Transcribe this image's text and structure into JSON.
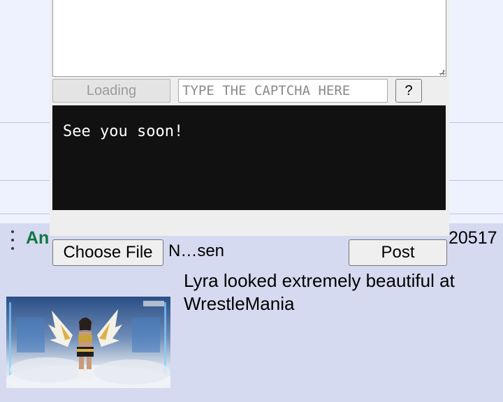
{
  "form": {
    "comment_value": "",
    "captcha_loading_label": "Loading",
    "captcha_placeholder": "TYPE THE CAPTCHA HERE",
    "captcha_help_label": "?",
    "captcha_text": "See you soon!",
    "choose_file_label": "Choose File",
    "file_name": "N…sen",
    "post_label": "Post"
  },
  "post": {
    "name_partial": "An",
    "number_partial": "20517",
    "comment": "Lyra looked extremely beautiful at WrestleMania"
  },
  "colors": {
    "page_bg": "#d6daf0",
    "name_color": "#117743",
    "captcha_bg": "#111111"
  }
}
